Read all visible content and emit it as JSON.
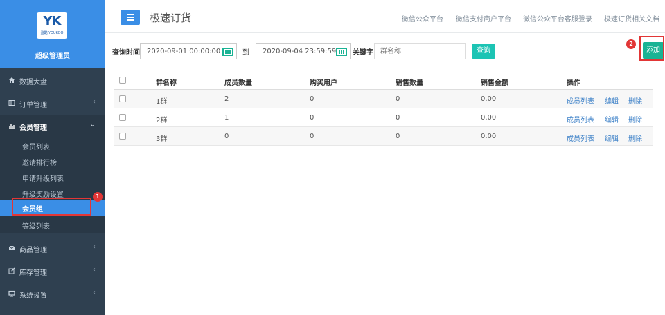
{
  "brand": {
    "logo_text": "YK",
    "logo_sub": "盈酷 YOUKOO",
    "admin_name": "超级管理员"
  },
  "sidebar": {
    "items": [
      {
        "label": "数据大盘",
        "icon": "home-icon"
      },
      {
        "label": "订单管理",
        "icon": "columns-icon"
      },
      {
        "label": "会员管理",
        "icon": "bar-chart-icon"
      },
      {
        "label": "商品管理",
        "icon": "envelope-icon"
      },
      {
        "label": "库存管理",
        "icon": "edit-icon"
      },
      {
        "label": "系统设置",
        "icon": "monitor-icon"
      }
    ],
    "member_sub": [
      "会员列表",
      "邀请排行榜",
      "申请升级列表",
      "升级奖励设置",
      "会员组",
      "等级列表"
    ]
  },
  "header": {
    "title": "极速订货",
    "links": [
      "微信公众平台",
      "微信支付商户平台",
      "微信公众平台客服登录",
      "极速订货相关文档"
    ]
  },
  "filter": {
    "time_label": "查询时间",
    "start": "2020-09-01 00:00:00",
    "to_label": "到",
    "end": "2020-09-04 23:59:59",
    "keyword_label": "关键字",
    "keyword_placeholder": "群名称",
    "query_button": "查询",
    "add_button": "添加"
  },
  "annotations": {
    "badge1": "1",
    "badge2": "2"
  },
  "table": {
    "headers": [
      "群名称",
      "成员数量",
      "购买用户",
      "销售数量",
      "销售金额",
      "操作"
    ],
    "actions": [
      "成员列表",
      "编辑",
      "删除"
    ],
    "rows": [
      {
        "name": "1群",
        "members": "2",
        "buyers": "0",
        "sales_qty": "0",
        "amount": "0.00"
      },
      {
        "name": "2群",
        "members": "1",
        "buyers": "0",
        "sales_qty": "0",
        "amount": "0.00"
      },
      {
        "name": "3群",
        "members": "0",
        "buyers": "0",
        "sales_qty": "0",
        "amount": "0.00"
      }
    ]
  },
  "colors": {
    "sidebar_bg": "#2f4050",
    "brand_blue": "#3a8ee6",
    "accent_green": "#1ab394",
    "highlight_red": "#e23636"
  }
}
